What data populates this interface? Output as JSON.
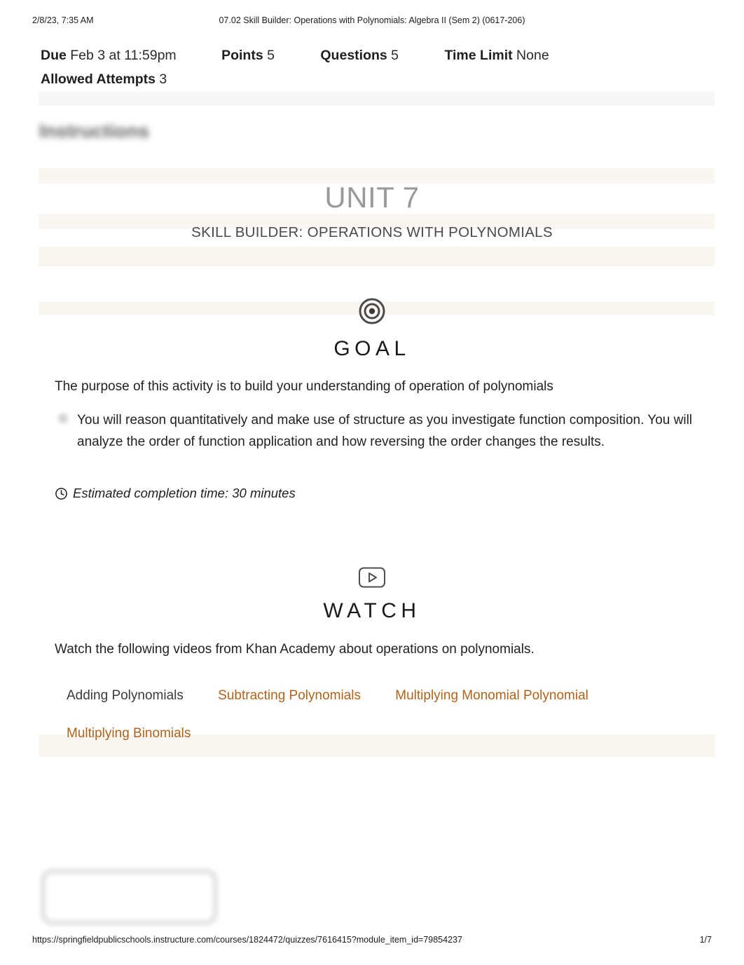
{
  "print_header": {
    "date": "2/8/23, 7:35 AM",
    "title": "07.02 Skill Builder: Operations with Polynomials: Algebra II (Sem 2) (0617-206)"
  },
  "quiz_meta": {
    "due_label": "Due",
    "due_value": "Feb 3 at 11:59pm",
    "points_label": "Points",
    "points_value": "5",
    "questions_label": "Questions",
    "questions_value": "5",
    "time_limit_label": "Time Limit",
    "time_limit_value": "None",
    "attempts_label": "Allowed Attempts",
    "attempts_value": "3"
  },
  "instructions_heading": "Instructions",
  "unit": {
    "title": "UNIT 7",
    "subtitle": "SKILL BUILDER: OPERATIONS WITH POLYNOMIALS"
  },
  "goal_section": {
    "icon": "target-icon",
    "heading": "GOAL",
    "intro": "The purpose of this activity is to build your understanding of operation of polynomials",
    "bullet": "You will reason quantitatively and make use of structure as you investigate function composition. You will analyze the order of function application and how reversing the order changes the results.",
    "estimate_icon": "clock-icon",
    "estimate": "Estimated completion time: 30 minutes"
  },
  "watch_section": {
    "icon": "play-video-icon",
    "heading": "WATCH",
    "intro": "Watch the following videos from Khan Academy about operations on polynomials.",
    "links": [
      {
        "label": "Adding Polynomials",
        "style": "plain"
      },
      {
        "label": "Subtracting Polynomials",
        "style": "link"
      },
      {
        "label": "Multiplying Monomial Polynomial",
        "style": "link"
      },
      {
        "label": "Multiplying Binomials",
        "style": "link"
      }
    ]
  },
  "print_footer": {
    "url": "https://springfieldpublicschools.instructure.com/courses/1824472/quizzes/7616415?module_item_id=79854237",
    "page": "1/7"
  },
  "colors": {
    "link": "#b0631b",
    "unit_title": "#9a9a9a",
    "band_warm": "#faf7f3"
  }
}
